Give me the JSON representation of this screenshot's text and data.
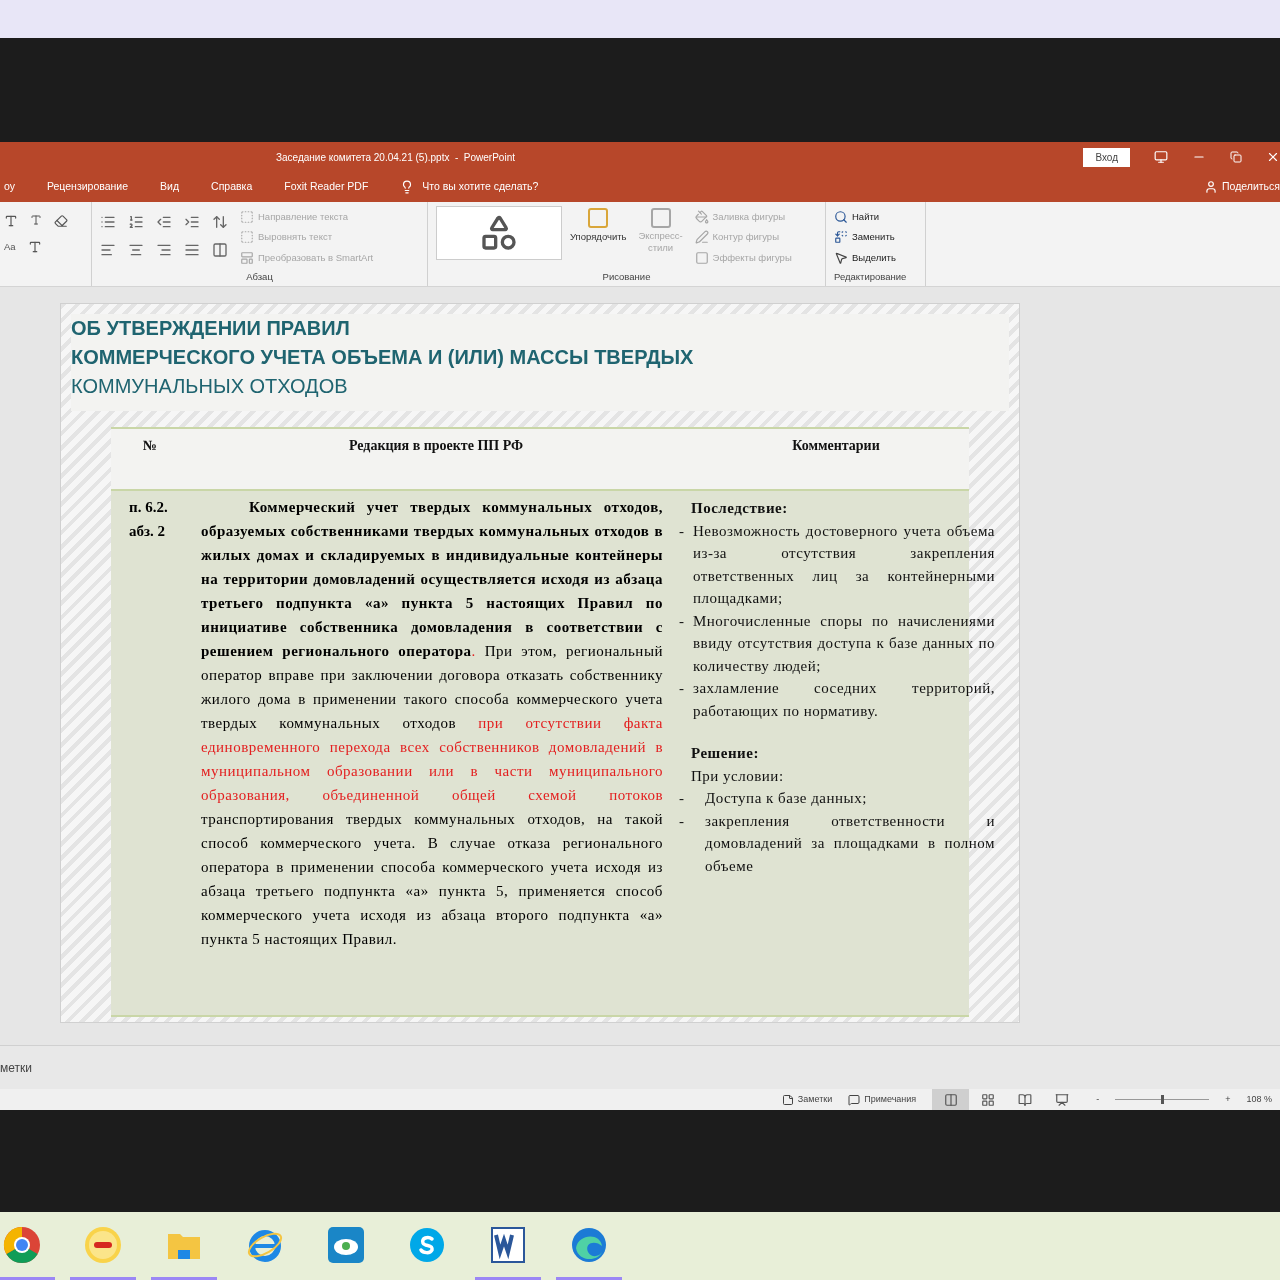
{
  "window": {
    "title": "Заседание комитета 20.04.21 (5).pptx  -  PowerPoint",
    "signin": "Вход"
  },
  "tabs": [
    {
      "label": "оу",
      "selected": false
    },
    {
      "label": "Рецензирование",
      "selected": false
    },
    {
      "label": "Вид",
      "selected": false
    },
    {
      "label": "Справка",
      "selected": false
    },
    {
      "label": "Foxit Reader PDF",
      "selected": false
    }
  ],
  "tell_me": "Что вы хотите сделать?",
  "share": "Поделиться",
  "ribbon": {
    "font_items": [
      "Aa"
    ],
    "paragraph_label": "Абзац",
    "paragraph_buttons": [
      {
        "label": "Направление текста",
        "disabled": true
      },
      {
        "label": "Выровнять текст",
        "disabled": true
      },
      {
        "label": "Преобразовать в SmartArt",
        "disabled": true
      }
    ],
    "drawing_label": "Рисование",
    "arrange": "Упорядочить",
    "quick_styles": "Экспресс-стили",
    "shape_buttons": [
      {
        "label": "Заливка фигуры",
        "disabled": true
      },
      {
        "label": "Контур фигуры",
        "disabled": true
      },
      {
        "label": "Эффекты фигуры",
        "disabled": true
      }
    ],
    "editing_label": "Редактирование",
    "editing_buttons": [
      {
        "label": "Найти",
        "kind": "find"
      },
      {
        "label": "Заменить",
        "kind": "replace"
      },
      {
        "label": "Выделить",
        "kind": "select"
      }
    ]
  },
  "slide": {
    "title_lines": [
      {
        "text": "ОБ УТВЕРЖДЕНИИ ПРАВИЛ",
        "bold": true
      },
      {
        "text": "КОММЕРЧЕСКОГО УЧЕТА ОБЪЕМА И (ИЛИ) МАССЫ ТВЕРДЫХ",
        "bold": true
      },
      {
        "text": "КОММУНАЛЬНЫХ ОТХОДОВ",
        "bold": false
      }
    ],
    "table": {
      "columns": [
        "№",
        "Редакция в проекте ПП РФ",
        "Комментарии"
      ],
      "row": {
        "number": "п. 6.2. абз. 2",
        "segments": [
          {
            "kind": "bold",
            "text": "Коммерческий учет твердых коммунальных отходов, образуемых собственниками твердых коммунальных отходов в жилых домах и складируемых в индивидуальные контейнеры на территории домовладений осуществляется исходя из абзаца третьего подпункта «а» пункта 5 настоящих Правил по инициативе собственника домовладения в соответствии с решением регионального оператора"
          },
          {
            "kind": "highlight",
            "text": "."
          },
          {
            "kind": "plain",
            "text": " При этом, региональный оператор вправе при заключении договора отказать собственнику жилого дома в применении такого способа коммерческого учета твердых коммунальных отходов "
          },
          {
            "kind": "highlight",
            "text": "при отсутствии факта единовременного перехода всех собственников домовладений в муниципальном образовании или в части муниципального образования, объединенной общей схемой потоков"
          },
          {
            "kind": "plain",
            "text": " транспортирования твердых коммунальных отходов, на такой способ коммерческого учета. В случае отказа регионального оператора в применении способа коммерческого учета исходя из абзаца третьего подпункта «а» пункта 5, применяется способ коммерческого учета исходя из абзаца второго подпункта «а» пункта 5 настоящих Правил."
          }
        ],
        "comment": {
          "consequence_heading": "Последствие:",
          "consequences": [
            {
              "marker": "-",
              "text": "Невозможность достоверного учета объема из-за отсутствия закрепления ответственных лиц за контейнерными площадками;"
            },
            {
              "marker": "-",
              "text": "Многочисленные споры по начислениями ввиду отсутствия доступа к базе данных по количеству людей;"
            },
            {
              "marker": "-",
              "text": "захламление соседних территорий, работающих по нормативу."
            }
          ],
          "solution_heading": "Решение:",
          "condition": "При условии:",
          "solutions": [
            {
              "marker": "-",
              "text": "Доступа к базе данных;"
            },
            {
              "marker": "-",
              "text": "закрепления ответственности и домовладений за площадками в полном объеме"
            }
          ]
        }
      }
    }
  },
  "notes_placeholder": "метки",
  "status_bar": {
    "notes": "Заметки",
    "comments": "Примечания",
    "views": [
      {
        "kind": "normal",
        "selected": true
      },
      {
        "kind": "sorter",
        "selected": false
      },
      {
        "kind": "reading",
        "selected": false
      },
      {
        "kind": "show",
        "selected": false
      }
    ],
    "zoom_minus": "-",
    "zoom_plus": "+",
    "zoom": {
      "level": 0.5
    },
    "zoom_text": "108 %"
  },
  "taskbar": [
    {
      "kind": "chrome",
      "running": true
    },
    {
      "kind": "onec",
      "running": true
    },
    {
      "kind": "explorer",
      "running": true
    },
    {
      "kind": "ie",
      "running": false
    },
    {
      "kind": "cloud",
      "running": false
    },
    {
      "kind": "skype",
      "running": false
    },
    {
      "kind": "word",
      "running": true
    },
    {
      "kind": "edge",
      "running": true
    }
  ]
}
